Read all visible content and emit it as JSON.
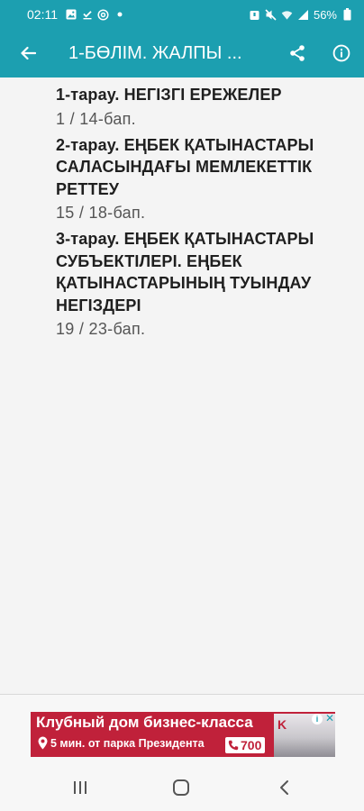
{
  "status_bar": {
    "time": "02:11",
    "battery": "56%",
    "left_icons": [
      "gallery-icon",
      "download-check-icon",
      "at-icon",
      "dot-icon"
    ],
    "right_icons": [
      "alarm-icon",
      "mute-icon",
      "wifi-icon",
      "signal-icon",
      "battery-icon"
    ]
  },
  "app_bar": {
    "title": "1-БӨЛІМ. ЖАЛПЫ ...",
    "back_icon": "arrow-back-icon",
    "share_icon": "share-icon",
    "info_icon": "info-icon"
  },
  "chapters": [
    {
      "title": "1-тарау. НЕГІЗГІ ЕРЕЖЕЛЕР",
      "range": "1 / 14-бап."
    },
    {
      "title": "2-тарау. ЕҢБЕК ҚАТЫНАСТАРЫ САЛАСЫНДАҒЫ МЕМЛЕКЕТТІК РЕТТЕУ",
      "range": "15 / 18-бап."
    },
    {
      "title": "3-тарау. ЕҢБЕК ҚАТЫНАСТАРЫ СУБЪЕКТІЛЕРІ. ЕҢБЕК ҚАТЫНАСТАРЫНЫҢ ТУЫНДАУ НЕГІЗДЕРІ",
      "range": "19 / 23-бап."
    }
  ],
  "ad": {
    "headline": "Клубный дом бизнес-класса",
    "subline": "5 мин. от парка Президента",
    "phone": "700",
    "brand": "K",
    "accent_color": "#c0213a"
  },
  "nav_bar": {
    "icons": [
      "recents-icon",
      "home-icon",
      "nav-back-icon"
    ]
  },
  "colors": {
    "primary": "#1c9fb0",
    "background": "#f4f4f4",
    "title_text": "#1f1f1f",
    "secondary_text": "#555555"
  }
}
